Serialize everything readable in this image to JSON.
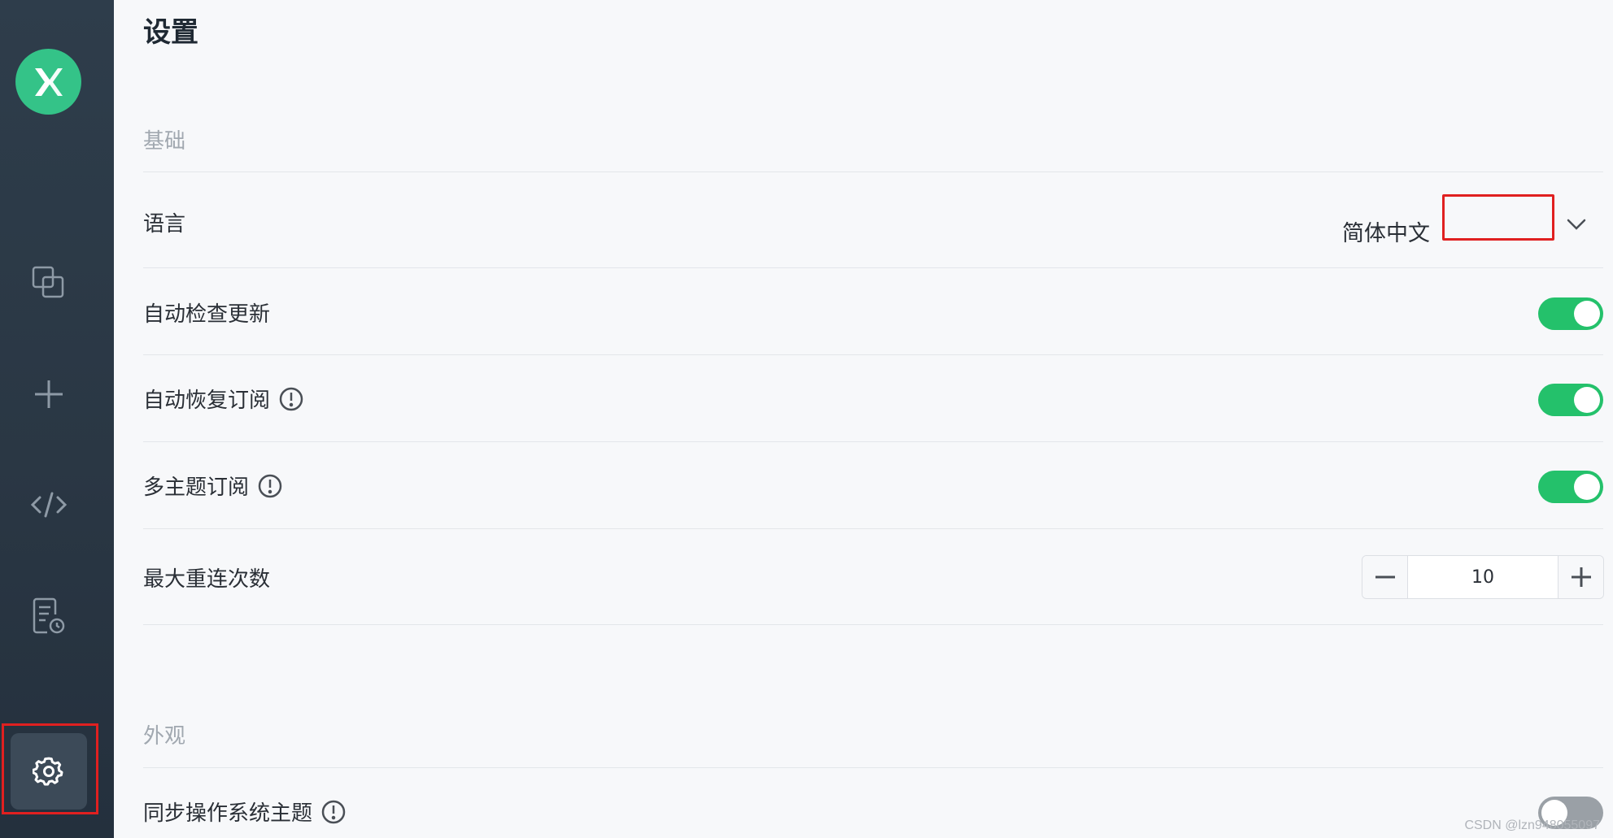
{
  "app": {
    "title": "设置"
  },
  "sidebar": {
    "items": [
      {
        "icon": "connections-icon"
      },
      {
        "icon": "plus-icon"
      },
      {
        "icon": "code-icon"
      },
      {
        "icon": "log-icon"
      },
      {
        "icon": "gear-icon",
        "active": true
      }
    ]
  },
  "sections": {
    "basic": {
      "title": "基础",
      "language": {
        "label": "语言",
        "value": "简体中文"
      },
      "auto_check_update": {
        "label": "自动检查更新",
        "on": true
      },
      "auto_resubscribe": {
        "label": "自动恢复订阅",
        "on": true
      },
      "multi_topic": {
        "label": "多主题订阅",
        "on": true
      },
      "max_reconnect": {
        "label": "最大重连次数",
        "value": "10"
      }
    },
    "appearance": {
      "title": "外观",
      "sync_os_theme": {
        "label": "同步操作系统主题",
        "on": false
      }
    }
  },
  "watermark": "CSDN @lzn948055097",
  "colors": {
    "accent": "#24c16b",
    "sidebar": "#2e3d4b",
    "highlight": "#e02020"
  }
}
